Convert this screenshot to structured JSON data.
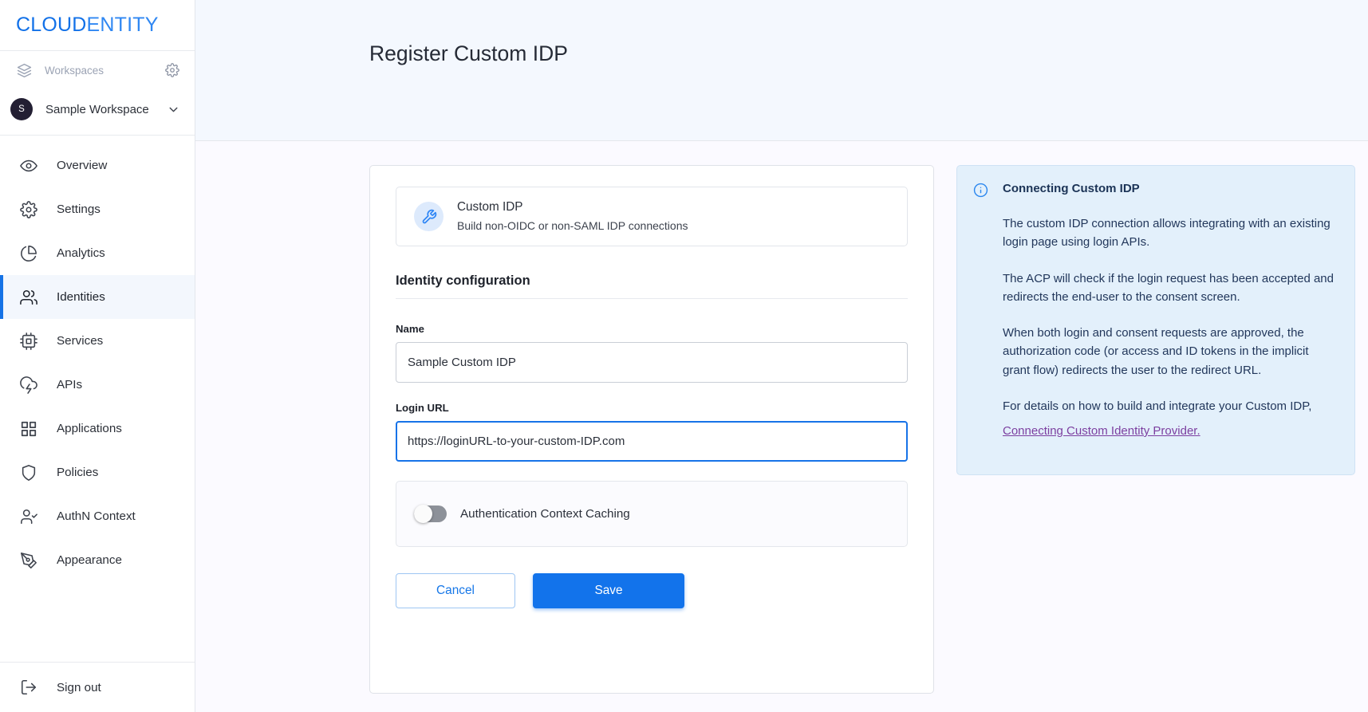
{
  "brand": {
    "part1": "CLOUD",
    "part2": "ENTITY",
    "color1": "#1271e8",
    "color2": "#2f87f2"
  },
  "sidebar": {
    "workspaces_label": "Workspaces",
    "workspaces_icon": "layers-icon",
    "settings_gear_icon": "gear-icon",
    "workspace": {
      "avatar_initial": "S",
      "name": "Sample Workspace",
      "caret_icon": "chevron-down-icon"
    },
    "items": [
      {
        "label": "Overview",
        "icon": "eye-icon",
        "active": false
      },
      {
        "label": "Settings",
        "icon": "gear-icon",
        "active": false
      },
      {
        "label": "Analytics",
        "icon": "pie-chart-icon",
        "active": false
      },
      {
        "label": "Identities",
        "icon": "users-icon",
        "active": true
      },
      {
        "label": "Services",
        "icon": "chip-icon",
        "active": false
      },
      {
        "label": "APIs",
        "icon": "cloud-lightning-icon",
        "active": false
      },
      {
        "label": "Applications",
        "icon": "grid-icon",
        "active": false
      },
      {
        "label": "Policies",
        "icon": "shield-icon",
        "active": false
      },
      {
        "label": "AuthN Context",
        "icon": "user-check-icon",
        "active": false
      },
      {
        "label": "Appearance",
        "icon": "pen-tool-icon",
        "active": false
      }
    ],
    "sign_out": {
      "label": "Sign out",
      "icon": "logout-icon"
    }
  },
  "header": {
    "title": "Register Custom IDP"
  },
  "form": {
    "idp_banner": {
      "icon": "wrench-icon",
      "title": "Custom IDP",
      "subtitle": "Build non-OIDC or non-SAML IDP connections"
    },
    "section_title": "Identity configuration",
    "fields": [
      {
        "label": "Name",
        "value": "Sample Custom IDP",
        "placeholder": "Name",
        "focused": false
      },
      {
        "label": "Login URL",
        "value": "https://loginURL-to-your-custom-IDP.com",
        "placeholder": "Login URL",
        "focused": true
      }
    ],
    "toggle": {
      "label": "Authentication Context Caching",
      "checked": false
    },
    "buttons": {
      "cancel": "Cancel",
      "save": "Save"
    }
  },
  "info_panel": {
    "icon": "info-icon",
    "title": "Connecting Custom IDP",
    "paragraphs": [
      "The custom IDP connection allows integrating with an existing login page using login APIs.",
      "The ACP will check if the login request has been accepted and redirects the end-user to the consent screen.",
      "When both login and consent requests are approved, the authorization code (or access and ID tokens in the implicit grant flow) redirects the user to the redirect URL.",
      "For details on how to build and integrate your Custom IDP,"
    ],
    "link": "Connecting Custom Identity Provider.",
    "link_color": "#7c3fa0"
  },
  "colors": {
    "accent": "#1273eb",
    "active_nav_bg": "#f3f7fd",
    "header_bg": "#f4f8fe",
    "info_bg": "#e3f0fb"
  }
}
